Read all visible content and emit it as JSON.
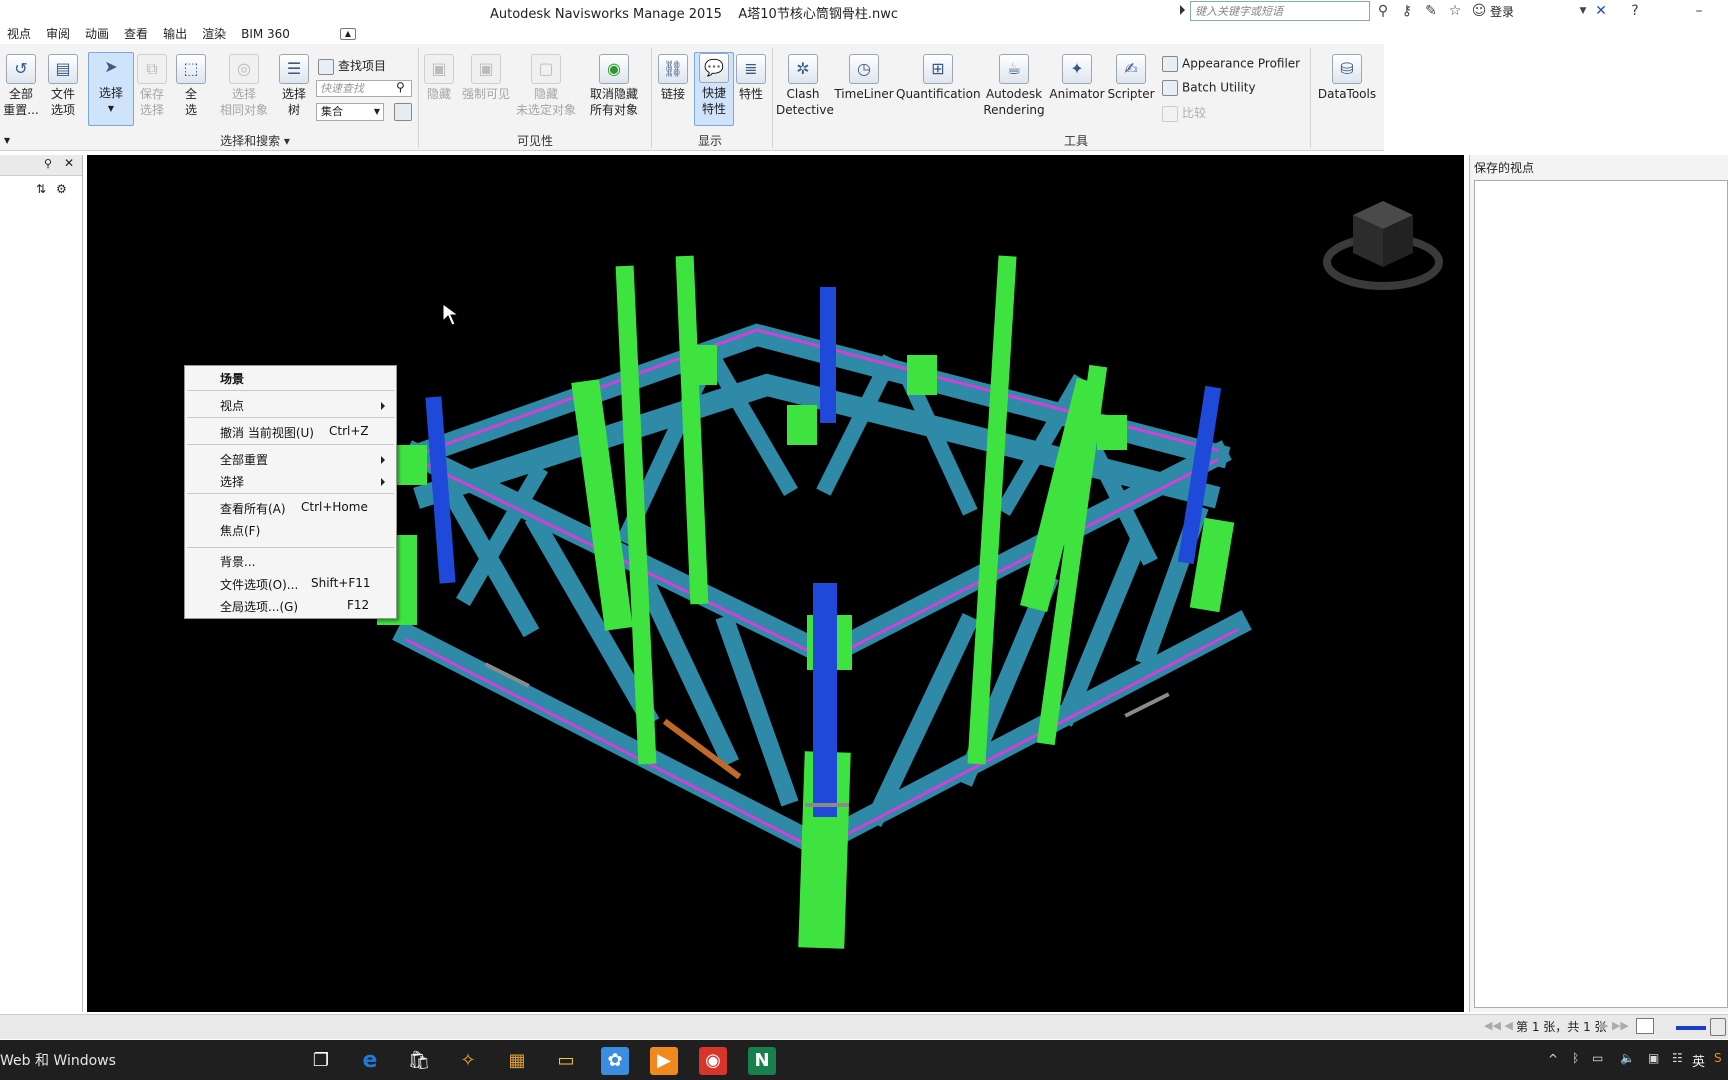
{
  "window": {
    "title": "Autodesk Navisworks Manage 2015",
    "file_name": "A塔10节核心筒钢骨柱.nwc",
    "search_placeholder": "键入关键字或短语",
    "login_label": "登录"
  },
  "menu_tabs": [
    "视点",
    "审阅",
    "动画",
    "查看",
    "输出",
    "渲染",
    "BIM 360"
  ],
  "ribbon": {
    "select_search": {
      "reset_all": "全部\n重置...",
      "file_options": "文件\n选项",
      "select": "选择",
      "save_selection": "保存\n选择",
      "select_all": "全\n选",
      "select_same": "选择\n相同对象",
      "selection_tree": "选择\n树",
      "find_items": "查找项目",
      "quick_find_placeholder": "快速查找",
      "sets_label": "集合",
      "group_label": "选择和搜索"
    },
    "visibility": {
      "hide": "隐藏",
      "require": "强制可见",
      "hide_unselected": "隐藏\n未选定对象",
      "unhide_all": "取消隐藏\n所有对象",
      "group_label": "可见性"
    },
    "display": {
      "links": "链接",
      "quick_props": "快捷\n特性",
      "properties": "特性",
      "group_label": "显示"
    },
    "tools": {
      "clash": "Clash\nDetective",
      "timeliner": "TimeLiner",
      "quantification": "Quantification",
      "rendering": "Autodesk\nRendering",
      "animator": "Animator",
      "scripter": "Scripter",
      "appearance_profiler": "Appearance Profiler",
      "batch_utility": "Batch Utility",
      "compare": "比较",
      "group_label": "工具"
    },
    "datatools": "DataTools"
  },
  "right_panel": {
    "title": "保存的视点"
  },
  "context_menu": {
    "header": "场景",
    "items": [
      {
        "label": "视点",
        "shortcut": ""
      },
      {
        "label": "撤消 当前视图(U)",
        "shortcut": "Ctrl+Z"
      },
      {
        "label": "全部重置",
        "shortcut": ""
      },
      {
        "label": "选择",
        "shortcut": ""
      },
      {
        "label": "查看所有(A)",
        "shortcut": "Ctrl+Home"
      },
      {
        "label": "焦点(F)",
        "shortcut": ""
      },
      {
        "label": "背景...",
        "shortcut": ""
      },
      {
        "label": "文件选项(O)...",
        "shortcut": "Shift+F11"
      },
      {
        "label": "全局选项...(G)",
        "shortcut": "F12"
      }
    ]
  },
  "status_bar": {
    "page_count": "第 1 张，共 1 张"
  },
  "taskbar": {
    "search_text": "Web 和 Windows",
    "tray_lang": "英"
  },
  "colors": {
    "viewport_bg": "#000000",
    "steel_green": "#3fe33f",
    "steel_blue": "#2f8aa8",
    "column_blue": "#1f49d8",
    "magenta": "#d041d6",
    "gray": "#8a8a8a"
  }
}
